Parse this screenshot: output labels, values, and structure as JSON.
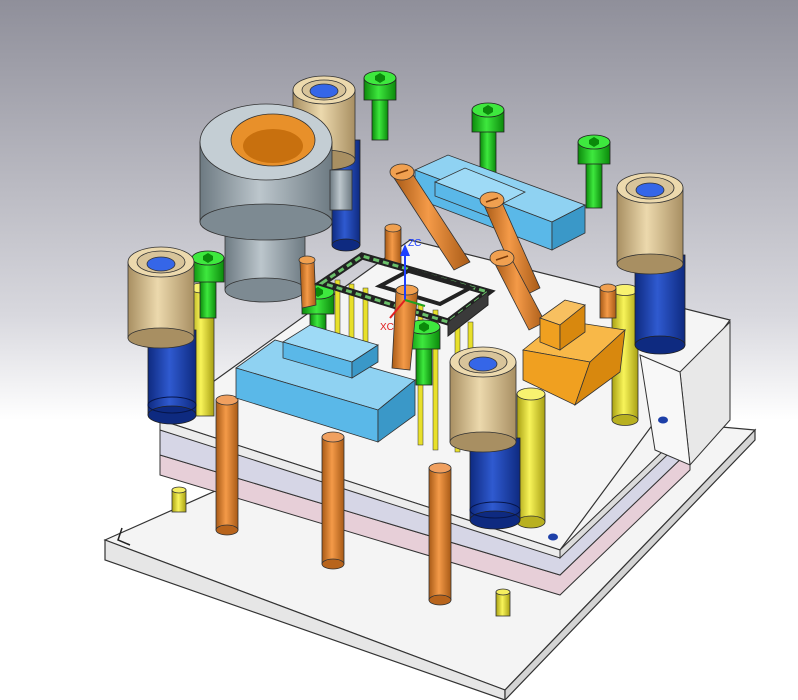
{
  "triad": {
    "z_label": "ZC",
    "x_label": "XC",
    "z_color": "#1e40ff",
    "x_color": "#e02020",
    "y_color": "#20a020"
  },
  "corner_mark": "L",
  "colors": {
    "background_top": "#8f8f9a",
    "background_bottom": "#ffffff",
    "base_plate": "#f2f2f2",
    "pink_plate": "#e7cfd8",
    "lavender_plate": "#d6d6e6",
    "upper_plate": "#f5f5f5",
    "guide_post_blue": "#1d3fa8",
    "bushing_tan": "#d8c49a",
    "green_screw": "#1fc41f",
    "slider_blue": "#5ab8e8",
    "orange_pin": "#e8802a",
    "yellow_pin": "#e8e02a",
    "sprue_bushing_grey": "#9aa6ae",
    "wedge_orange": "#f0a020"
  },
  "icons": [
    "coordinate-triad-icon",
    "corner-l-mark-icon"
  ]
}
